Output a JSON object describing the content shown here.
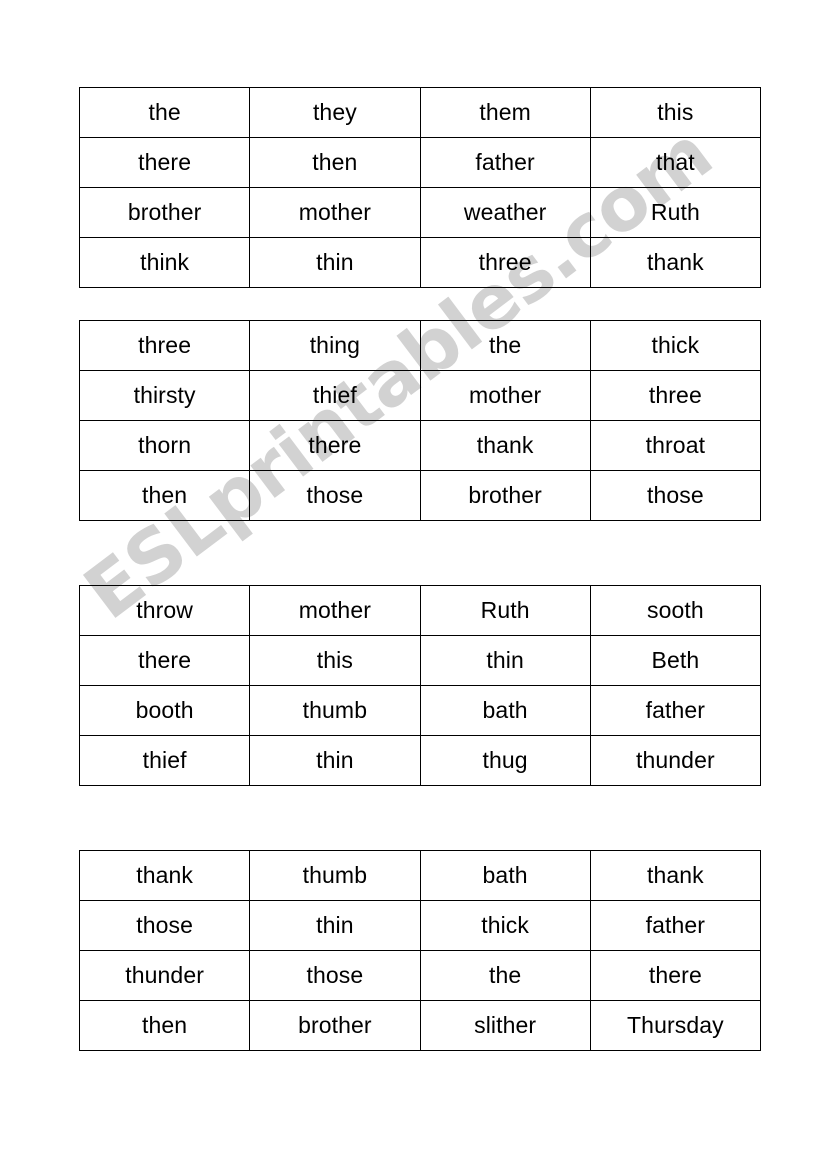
{
  "page": {
    "type": "worksheet",
    "background_color": "#ffffff",
    "text_color": "#000000",
    "border_color": "#000000"
  },
  "watermark": {
    "text": "ESLprintables.com",
    "color": "#d2d2d2",
    "rotation_degrees": -37
  },
  "tables": [
    {
      "id": "table-1",
      "rows": [
        [
          "the",
          "they",
          "them",
          "this"
        ],
        [
          "there",
          "then",
          "father",
          "that"
        ],
        [
          "brother",
          "mother",
          "weather",
          "Ruth"
        ],
        [
          "think",
          "thin",
          "three",
          "thank"
        ]
      ]
    },
    {
      "id": "table-2",
      "rows": [
        [
          "three",
          "thing",
          "the",
          "thick"
        ],
        [
          "thirsty",
          "thief",
          "mother",
          "three"
        ],
        [
          "thorn",
          "there",
          "thank",
          "throat"
        ],
        [
          "then",
          "those",
          "brother",
          "those"
        ]
      ]
    },
    {
      "id": "table-3",
      "rows": [
        [
          "throw",
          "mother",
          "Ruth",
          "sooth"
        ],
        [
          "there",
          "this",
          "thin",
          "Beth"
        ],
        [
          "booth",
          "thumb",
          "bath",
          "father"
        ],
        [
          "thief",
          "thin",
          "thug",
          "thunder"
        ]
      ]
    },
    {
      "id": "table-4",
      "rows": [
        [
          "thank",
          "thumb",
          "bath",
          "thank"
        ],
        [
          "those",
          "thin",
          "thick",
          "father"
        ],
        [
          "thunder",
          "those",
          "the",
          "there"
        ],
        [
          "then",
          "brother",
          "slither",
          "Thursday"
        ]
      ]
    }
  ]
}
